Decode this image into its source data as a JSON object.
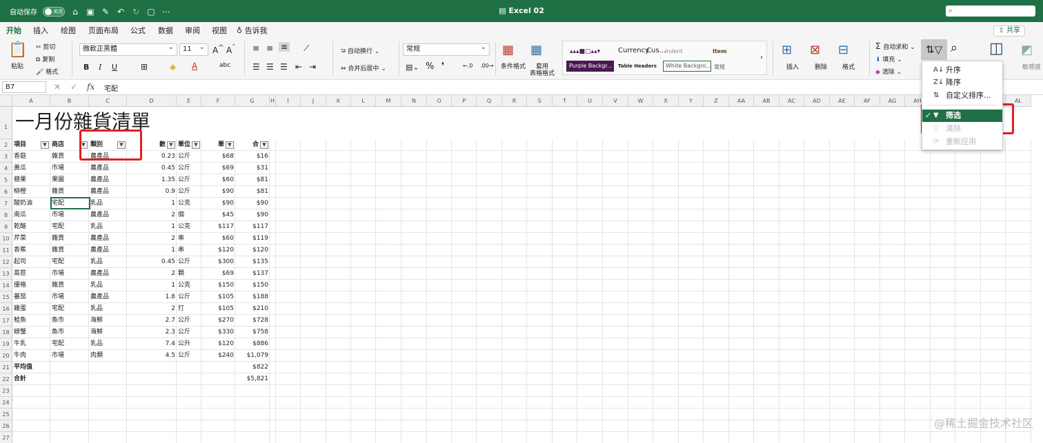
{
  "titlebar": {
    "autosave": "自动保存",
    "toggle": "关闭",
    "title": "Excel 02",
    "search_placeholder": ""
  },
  "tabs": [
    "开始",
    "插入",
    "绘图",
    "页面布局",
    "公式",
    "数据",
    "审阅",
    "视图",
    "告诉我"
  ],
  "share": "共享",
  "ribbon": {
    "paste": "粘贴",
    "cut": "剪切",
    "copy": "复制",
    "format_painter": "格式",
    "font_name": "微軟正黑體",
    "font_size": "11",
    "bold": "B",
    "italic": "I",
    "underline": "U",
    "wrap": "自动换行",
    "merge": "合并后居中",
    "number_format": "常规",
    "cond_format": "条件格式",
    "table_format_1": "套用",
    "table_format_2": "表格格式",
    "styles": {
      "currency": "Currency",
      "cus": "Cus...",
      "indent": "Indent",
      "item": "Item",
      "purple": "Purple Backgr...",
      "table_headers": "Table Headers",
      "white": "White Backgro...",
      "normal": "常规"
    },
    "insert": "插入",
    "delete": "删除",
    "format": "格式",
    "autosum": "自动求和",
    "fill": "填充",
    "clear": "清除",
    "sensitivity": "敏感度"
  },
  "formula_bar": {
    "name_box": "B7",
    "fx": "fx",
    "value": "宅配"
  },
  "columns": [
    "A",
    "B",
    "C",
    "D",
    "E",
    "F",
    "G",
    "H",
    "I",
    "J",
    "K",
    "L",
    "M",
    "N",
    "O",
    "P",
    "Q",
    "R",
    "S",
    "T",
    "U",
    "V",
    "W",
    "X",
    "Y",
    "Z",
    "AA",
    "AB",
    "AC",
    "AD",
    "AE",
    "AF",
    "AG",
    "AH",
    "AI",
    "AJ",
    "AK",
    "AL"
  ],
  "rows": [
    "1",
    "2",
    "3",
    "4",
    "5",
    "6",
    "7",
    "8",
    "9",
    "10",
    "11",
    "12",
    "13",
    "14",
    "15",
    "16",
    "17",
    "18",
    "19",
    "20",
    "21",
    "22",
    "23",
    "24",
    "25",
    "26",
    "27"
  ],
  "sheet": {
    "title": "一月份雜貨清單",
    "headers": [
      "項目",
      "商店",
      "類別",
      "數",
      "單位",
      "單",
      "合"
    ],
    "data": [
      [
        "香菇",
        "雜貨",
        "農產品",
        "0.23",
        "公斤",
        "$68",
        "$16"
      ],
      [
        "黃瓜",
        "市場",
        "農產品",
        "0.45",
        "公斤",
        "$69",
        "$31"
      ],
      [
        "蘋果",
        "果園",
        "農產品",
        "1.35",
        "公斤",
        "$60",
        "$81"
      ],
      [
        "柳橙",
        "雜貨",
        "農產品",
        "0.9",
        "公斤",
        "$90",
        "$81"
      ],
      [
        "酸奶油",
        "宅配",
        "乳品",
        "1",
        "公克",
        "$90",
        "$90"
      ],
      [
        "南瓜",
        "市場",
        "農產品",
        "2",
        "個",
        "$45",
        "$90"
      ],
      [
        "乾酪",
        "宅配",
        "乳品",
        "1",
        "公克",
        "$117",
        "$117"
      ],
      [
        "芹菜",
        "雜貨",
        "農產品",
        "2",
        "串",
        "$60",
        "$119"
      ],
      [
        "香蕉",
        "雜貨",
        "農產品",
        "1",
        "串",
        "$120",
        "$120"
      ],
      [
        "起司",
        "宅配",
        "乳品",
        "0.45",
        "公斤",
        "$300",
        "$135"
      ],
      [
        "萵苣",
        "市場",
        "農產品",
        "2",
        "顆",
        "$69",
        "$137"
      ],
      [
        "優格",
        "雜貨",
        "乳品",
        "1",
        "公克",
        "$150",
        "$150"
      ],
      [
        "蕃茄",
        "市場",
        "農產品",
        "1.8",
        "公斤",
        "$105",
        "$188"
      ],
      [
        "雞蛋",
        "宅配",
        "乳品",
        "2",
        "打",
        "$105",
        "$210"
      ],
      [
        "鮭魚",
        "魚市",
        "海鮮",
        "2.7",
        "公斤",
        "$270",
        "$728"
      ],
      [
        "螃蟹",
        "魚市",
        "海鮮",
        "2.3",
        "公斤",
        "$330",
        "$758"
      ],
      [
        "牛乳",
        "宅配",
        "乳品",
        "7.4",
        "公升",
        "$120",
        "$886"
      ],
      [
        "牛肉",
        "市場",
        "肉類",
        "4.5",
        "公斤",
        "$240",
        "$1,079"
      ]
    ],
    "avg_label": "平均值",
    "avg_value": "$822",
    "total_label": "合計",
    "total_value": "$5,821"
  },
  "sort_filter_menu": {
    "asc": "升序",
    "desc": "降序",
    "custom": "自定义排序...",
    "filter": "筛选",
    "clear": "清除",
    "reapply": "重新应用"
  },
  "watermark": "@稀土掘金技术社区",
  "colors": {
    "accent": "#1f7145",
    "highlight_box": "#e0201c"
  }
}
